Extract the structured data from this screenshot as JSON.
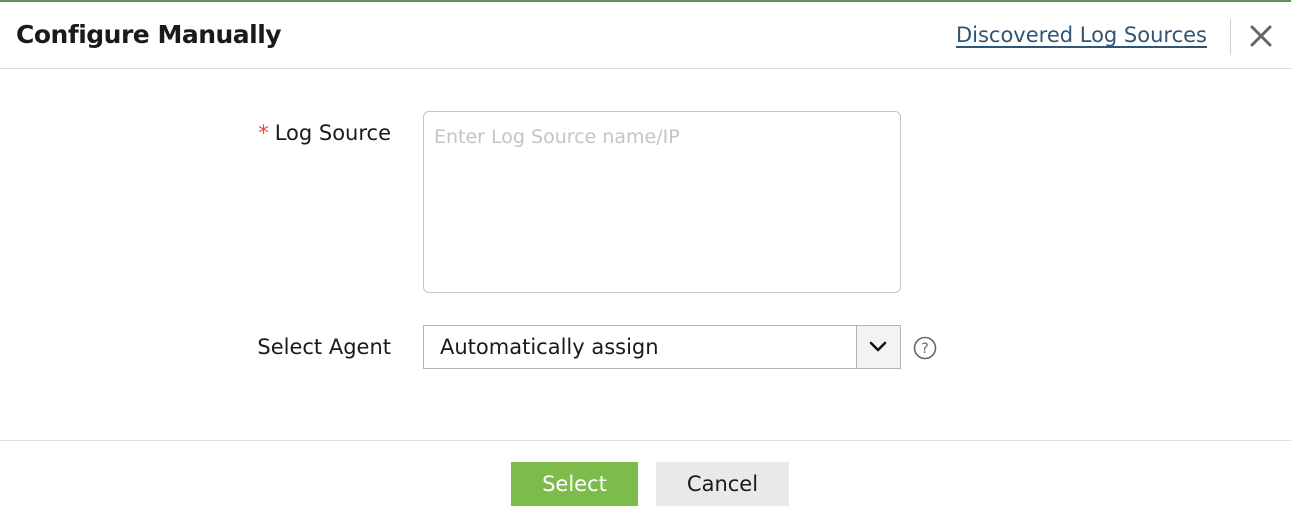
{
  "dialog": {
    "title": "Configure Manually",
    "discovered_link": "Discovered Log Sources",
    "close_icon": "close-icon"
  },
  "form": {
    "log_source": {
      "required_marker": "*",
      "label": "Log Source",
      "placeholder": "Enter Log Source name/IP",
      "value": ""
    },
    "agent": {
      "label": "Select Agent",
      "selected": "Automatically assign",
      "dropdown_icon": "chevron-down-icon",
      "help_icon": "help-icon"
    }
  },
  "footer": {
    "select_label": "Select",
    "cancel_label": "Cancel"
  },
  "colors": {
    "accent_top": "#5f8f57",
    "primary_button": "#7dbb4a",
    "link": "#2f5577",
    "required": "#e04848"
  }
}
